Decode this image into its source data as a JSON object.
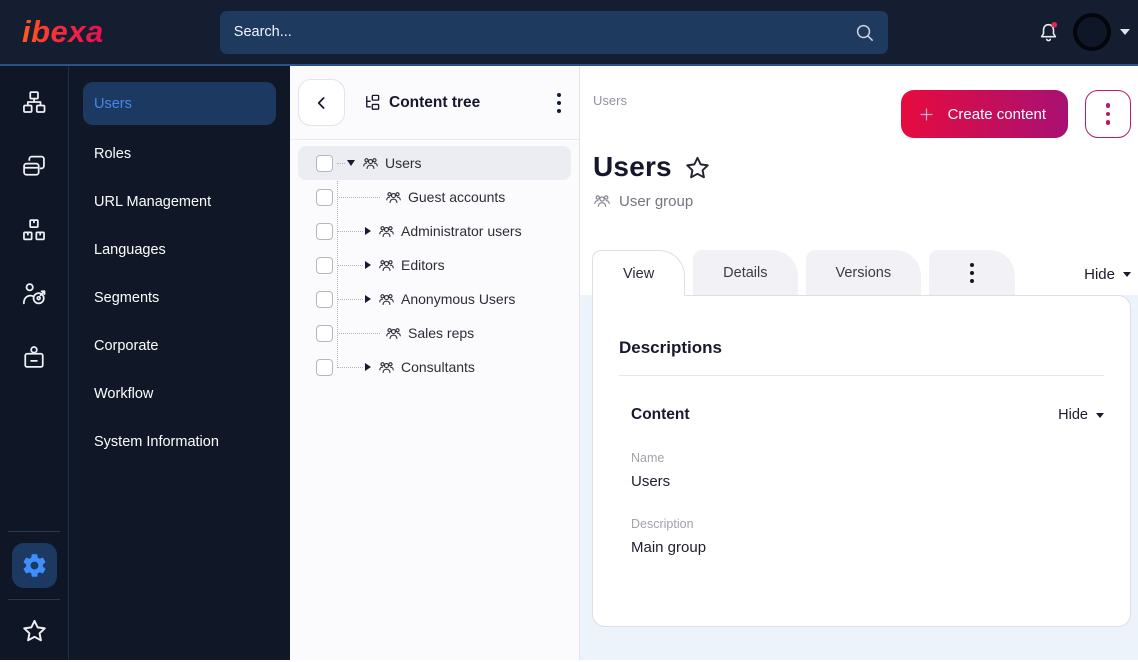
{
  "topbar": {
    "logo_text": "ibexa",
    "search_placeholder": "Search...",
    "icons": [
      "search-icon",
      "notifications-bell-icon",
      "user-avatar",
      "caret-down-icon"
    ]
  },
  "rail": {
    "icons": [
      "sitemap-icon",
      "pages-stack-icon",
      "modules-boxes-icon",
      "personalization-target-icon",
      "id-badge-icon",
      "gear-icon",
      "star-icon"
    ],
    "active_item": "gear"
  },
  "sidebar": {
    "items": [
      {
        "label": "Users",
        "active": true
      },
      {
        "label": "Roles",
        "active": false
      },
      {
        "label": "URL Management",
        "active": false
      },
      {
        "label": "Languages",
        "active": false
      },
      {
        "label": "Segments",
        "active": false
      },
      {
        "label": "Corporate",
        "active": false
      },
      {
        "label": "Workflow",
        "active": false
      },
      {
        "label": "System Information",
        "active": false
      }
    ]
  },
  "tree_panel": {
    "title": "Content tree",
    "items": [
      {
        "label": "Users",
        "expanded": true,
        "selected": true,
        "level": 0
      },
      {
        "label": "Guest accounts",
        "expanded": null,
        "selected": false,
        "level": 1
      },
      {
        "label": "Administrator users",
        "expanded": false,
        "selected": false,
        "level": 1
      },
      {
        "label": "Editors",
        "expanded": false,
        "selected": false,
        "level": 1
      },
      {
        "label": "Anonymous Users",
        "expanded": false,
        "selected": false,
        "level": 1
      },
      {
        "label": "Sales reps",
        "expanded": null,
        "selected": false,
        "level": 1
      },
      {
        "label": "Consultants",
        "expanded": false,
        "selected": false,
        "level": 1
      }
    ]
  },
  "main": {
    "breadcrumb": "Users",
    "create_button_label": "Create content",
    "title": "Users",
    "content_type_label": "User group",
    "tabs": [
      {
        "label": "View",
        "active": true
      },
      {
        "label": "Details",
        "active": false
      },
      {
        "label": "Versions",
        "active": false
      }
    ],
    "hide_toggle_label": "Hide",
    "card": {
      "heading": "Descriptions",
      "section_title": "Content",
      "section_toggle_label": "Hide",
      "fields": [
        {
          "label": "Name",
          "value": "Users"
        },
        {
          "label": "Description",
          "value": "Main group"
        }
      ]
    }
  },
  "colors": {
    "topbar_bg": "#151e31",
    "topbar_underline": "#2b5287",
    "search_bg": "#1e3a5e",
    "rail_bg": "#0f1726",
    "sidebar_bg": "#101827",
    "active_item_bg": "#1c3a61",
    "accent_blue": "#4687ea",
    "magenta": "#bb1a68",
    "button_grad_start": "#e60b3f",
    "button_grad_end": "#a81173",
    "body_bg": "#edf3fb",
    "notification_dot": "#e02a4f"
  }
}
